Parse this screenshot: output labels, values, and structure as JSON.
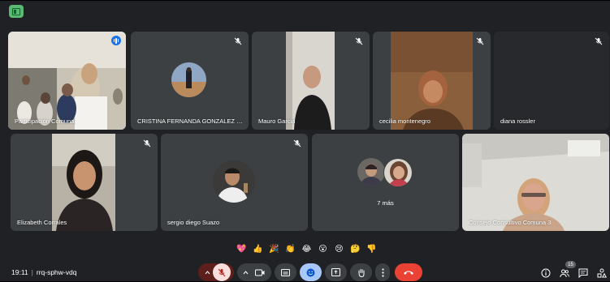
{
  "participants": [
    {
      "name": "Participación Comunal",
      "speaking": true
    },
    {
      "name": "CRISTINA FERNANDA GONZALEZ LU...",
      "muted": true
    },
    {
      "name": "Mauro Garcia",
      "muted": true
    },
    {
      "name": "cecilia montenegro",
      "muted": true
    },
    {
      "name": "diana rossler",
      "muted": true
    },
    {
      "name": "Elizabeth Corrales",
      "muted": true
    },
    {
      "name": "sergio diego Suazo",
      "muted": true
    },
    {
      "name": "Consejo Consultivo Comuna 3",
      "muted": false
    }
  ],
  "more_tile": {
    "label": "7 más"
  },
  "reactions": [
    "💖",
    "👍",
    "🎉",
    "👏",
    "😂",
    "😮",
    "😢",
    "🤔",
    "👎"
  ],
  "meeting": {
    "time": "19:11",
    "separator": "|",
    "code": "rrq-sphw-vdq"
  },
  "people_count": "15",
  "colors": {
    "background": "#202124",
    "tile": "#3c4043",
    "hangup": "#ea4335",
    "active": "#8ab4f8",
    "mic_off": "#f28b82"
  }
}
